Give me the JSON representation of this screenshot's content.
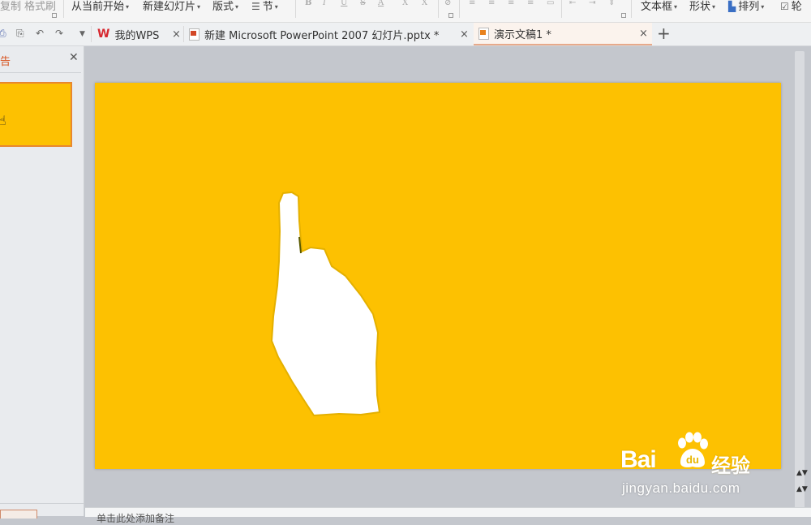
{
  "ribbon": {
    "copy_label": "复制",
    "format_painter_label": "格式刷",
    "play_from_current_label": "从当前开始",
    "new_slide_label": "新建幻灯片",
    "layout_label": "版式",
    "section_label": "节",
    "bold": "B",
    "italic": "I",
    "underline": "U",
    "strike": "S",
    "font_color": "A",
    "superscript": "X",
    "subscript": "X",
    "textbox_label": "文本框",
    "shape_label": "形状",
    "arrange_label": "排列",
    "outline_label": "轮"
  },
  "tabs": [
    {
      "label": "我的WPS",
      "icon": "wps-logo-icon",
      "active": false
    },
    {
      "label": "新建 Microsoft PowerPoint 2007 幻灯片.pptx *",
      "icon": "pptx-file-icon",
      "active": false
    },
    {
      "label": "演示文稿1 *",
      "icon": "presentation-file-icon",
      "active": true
    }
  ],
  "left_panel": {
    "header": "告"
  },
  "notes": {
    "placeholder": "单击此处添加备注"
  },
  "watermark": {
    "brand": "Bai",
    "brand_tail": "du",
    "cn": "经验",
    "url": "jingyan.baidu.com"
  },
  "colors": {
    "slide_background": "#fdc101",
    "active_tab_underline": "#e7a98a",
    "thumbnail_border": "#e8872e",
    "workspace": "#c4c7cd"
  }
}
